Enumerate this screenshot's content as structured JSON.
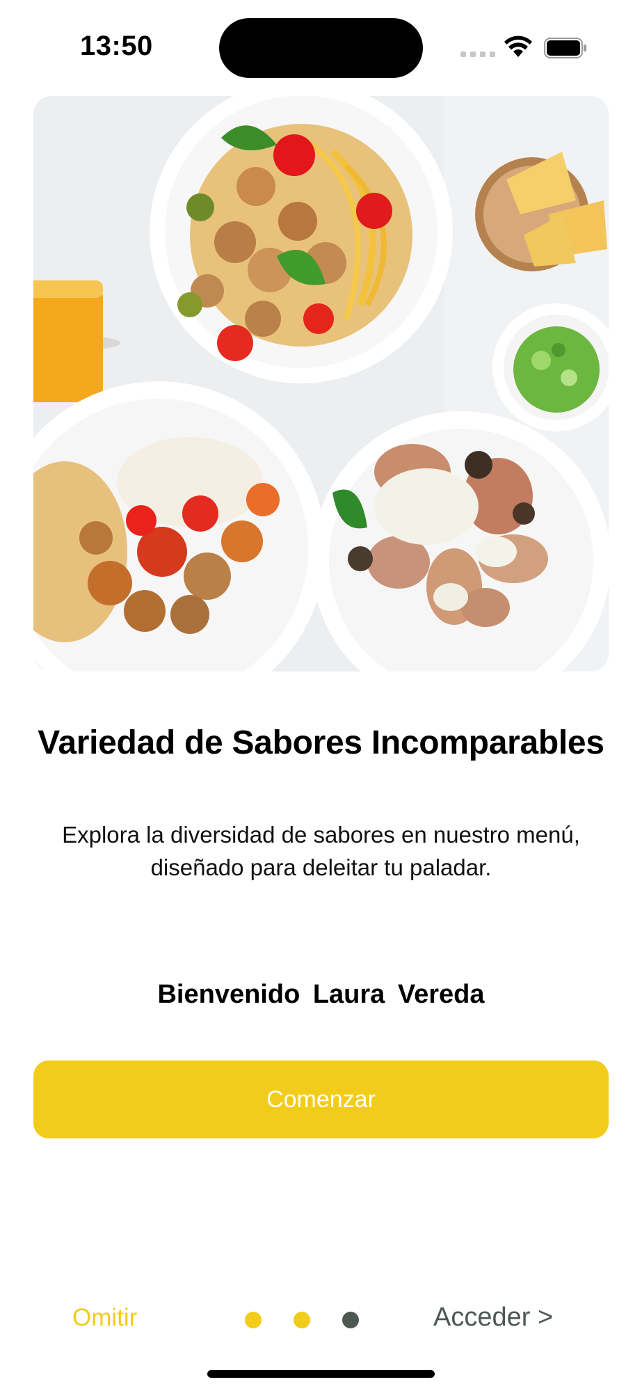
{
  "status_bar": {
    "time": "13:50",
    "icons": [
      "cellular-signal-icon",
      "wifi-icon",
      "battery-icon"
    ]
  },
  "hero": {
    "image": "food-platters-photo"
  },
  "onboarding": {
    "title": "Variedad de Sabores Incomparables",
    "description": "Explora la diversidad de sabores en nuestro menú, diseñado para deleitar tu paladar.",
    "welcome": "Bienvenido  Laura  Vereda",
    "start_button": "Comenzar"
  },
  "footer": {
    "skip_label": "Omitir",
    "access_label": "Acceder >",
    "page_indicator": {
      "total": 3,
      "current": 3
    }
  },
  "colors": {
    "accent": "#f2cc1a",
    "dot_active": "#4d5853",
    "dot_inactive": "#f2cc1a",
    "access_text": "#4d5853"
  }
}
